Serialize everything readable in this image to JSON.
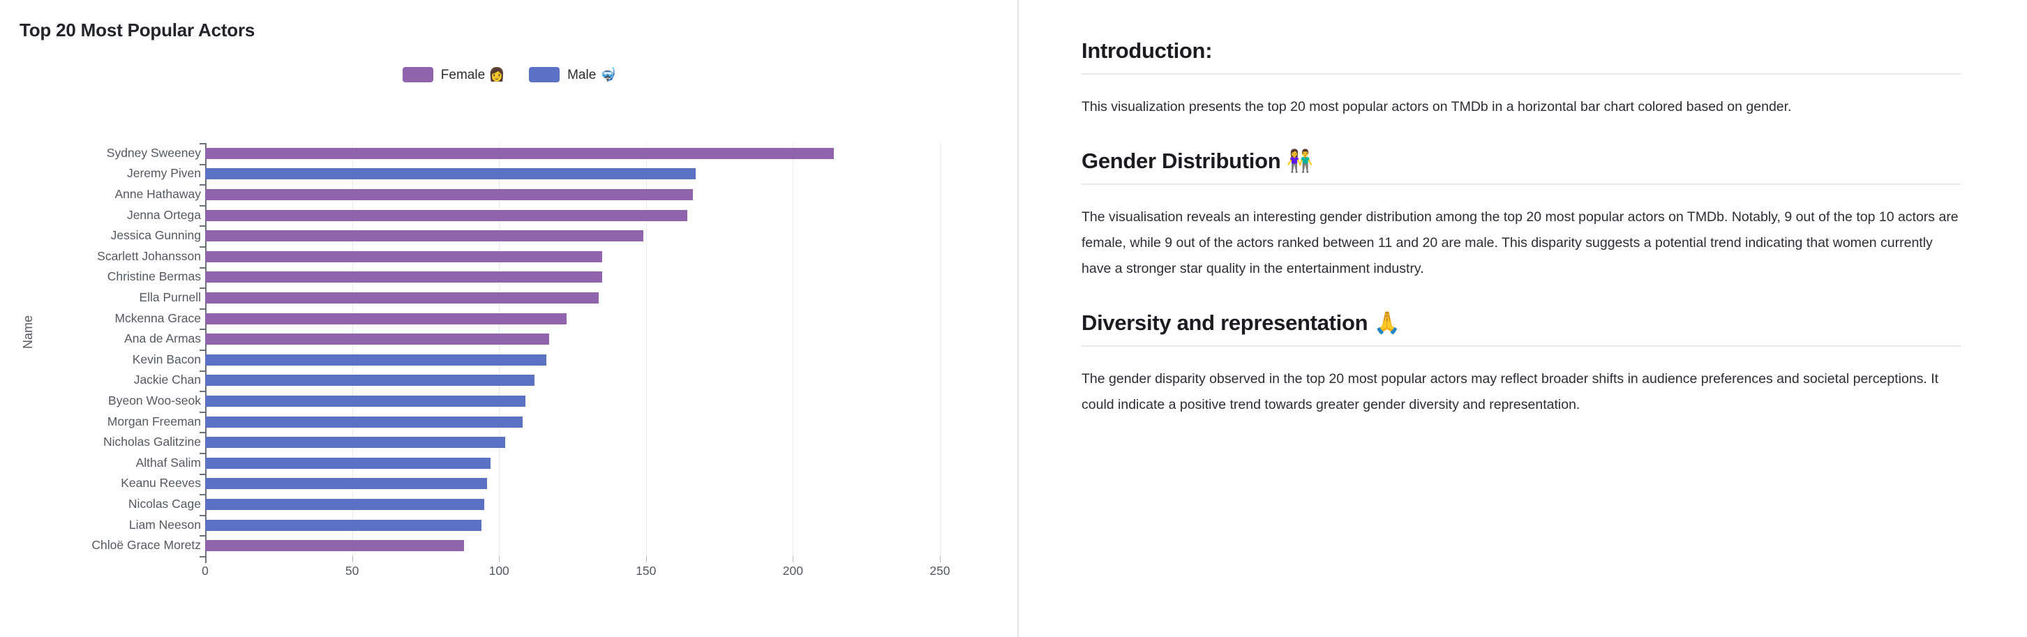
{
  "chart_panel": {
    "title": "Top 20 Most Popular Actors",
    "legend": [
      {
        "label": "Female 👩",
        "color": "#9063ad",
        "key": "female"
      },
      {
        "label": "Male 🤿",
        "color": "#5a71c4",
        "key": "male"
      }
    ]
  },
  "chart_data": {
    "type": "bar",
    "orientation": "horizontal",
    "title": "Top 20 Most Popular Actors",
    "xlabel": "",
    "ylabel": "Name",
    "xlim": [
      0,
      250
    ],
    "xticks": [
      0,
      50,
      100,
      150,
      200,
      250
    ],
    "grid": true,
    "legend_position": "top-center",
    "legend": [
      "Female 👩",
      "Male 🤿"
    ],
    "colors": {
      "Female": "#9063ad",
      "Male": "#5a71c4"
    },
    "categories": [
      "Sydney Sweeney",
      "Jeremy Piven",
      "Anne Hathaway",
      "Jenna Ortega",
      "Jessica Gunning",
      "Scarlett Johansson",
      "Christine Bermas",
      "Ella Purnell",
      "Mckenna Grace",
      "Ana de Armas",
      "Kevin Bacon",
      "Jackie Chan",
      "Byeon Woo-seok",
      "Morgan Freeman",
      "Nicholas Galitzine",
      "Althaf Salim",
      "Keanu Reeves",
      "Nicolas Cage",
      "Liam Neeson",
      "Chloë Grace Moretz"
    ],
    "values": [
      214,
      167,
      166,
      164,
      149,
      135,
      135,
      134,
      123,
      117,
      116,
      112,
      109,
      108,
      102,
      97,
      96,
      95,
      94,
      88
    ],
    "genders": [
      "Female",
      "Male",
      "Female",
      "Female",
      "Female",
      "Female",
      "Female",
      "Female",
      "Female",
      "Female",
      "Male",
      "Male",
      "Male",
      "Male",
      "Male",
      "Male",
      "Male",
      "Male",
      "Male",
      "Female"
    ]
  },
  "article": {
    "sections": [
      {
        "heading": "Introduction:",
        "body": "This visualization presents the top 20 most popular actors on TMDb in a horizontal bar chart colored based on gender."
      },
      {
        "heading": "Gender Distribution 👫",
        "body": "The visualisation reveals an interesting gender distribution among the top 20 most popular actors on TMDb. Notably, 9 out of the top 10 actors are female, while 9 out of the actors ranked between 11 and 20 are male. This disparity suggests a potential trend indicating that women currently have a stronger star quality in the entertainment industry."
      },
      {
        "heading": "Diversity and representation 🙏",
        "body": "The gender disparity observed in the top 20 most popular actors may reflect broader shifts in audience preferences and societal perceptions. It could indicate a positive trend towards greater gender diversity and representation."
      }
    ]
  }
}
